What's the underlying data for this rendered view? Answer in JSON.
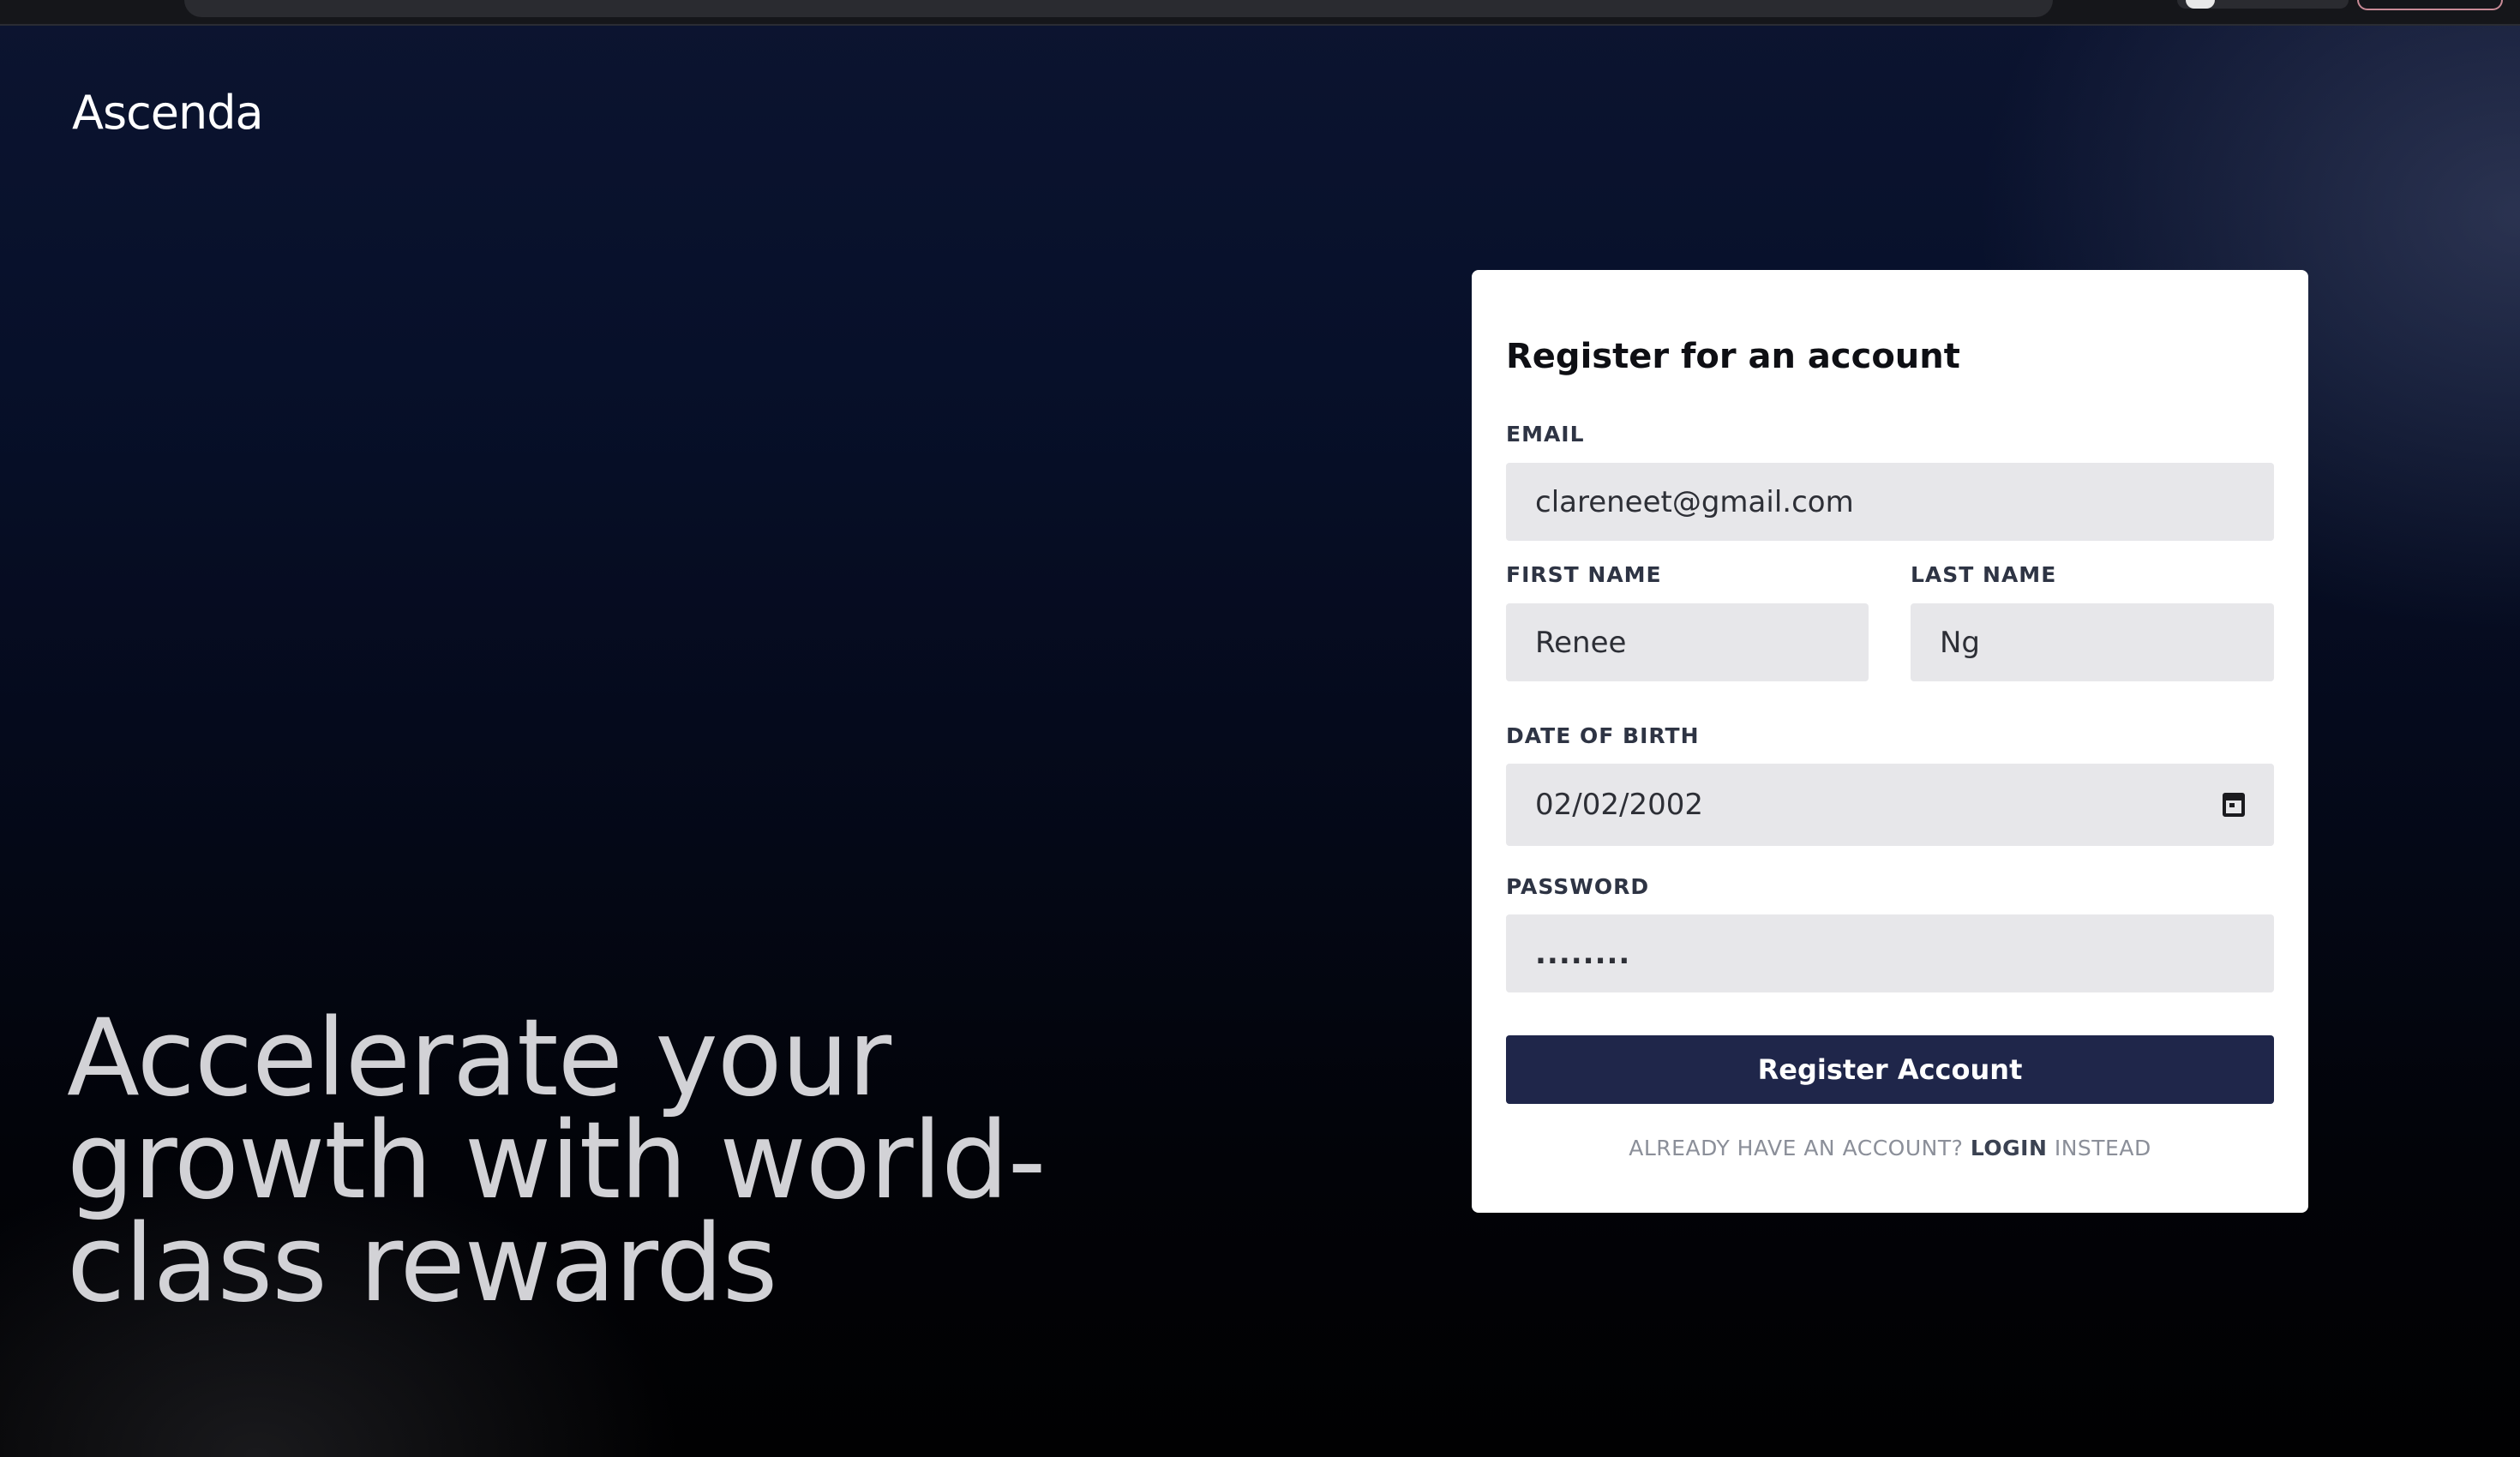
{
  "brand": {
    "logo_text": "Ascenda"
  },
  "hero": {
    "line1": "Accelerate your",
    "line2": "growth with world-",
    "line3": "class rewards"
  },
  "form": {
    "title": "Register for an account",
    "email_label": "EMAIL",
    "email_value": "clareneet@gmail.com",
    "first_name_label": "FIRST NAME",
    "first_name_value": "Renee",
    "last_name_label": "LAST NAME",
    "last_name_value": "Ng",
    "dob_label": "DATE OF BIRTH",
    "dob_value": "02/02/2002",
    "password_label": "PASSWORD",
    "password_value": "........",
    "submit_label": "Register Account",
    "login_prefix": "ALREADY HAVE AN ACCOUNT?",
    "login_link": "LOGIN",
    "login_suffix": "INSTEAD"
  },
  "colors": {
    "primary_button": "#1f264a",
    "input_background": "#e7e7ea",
    "card_background": "#ffffff"
  }
}
